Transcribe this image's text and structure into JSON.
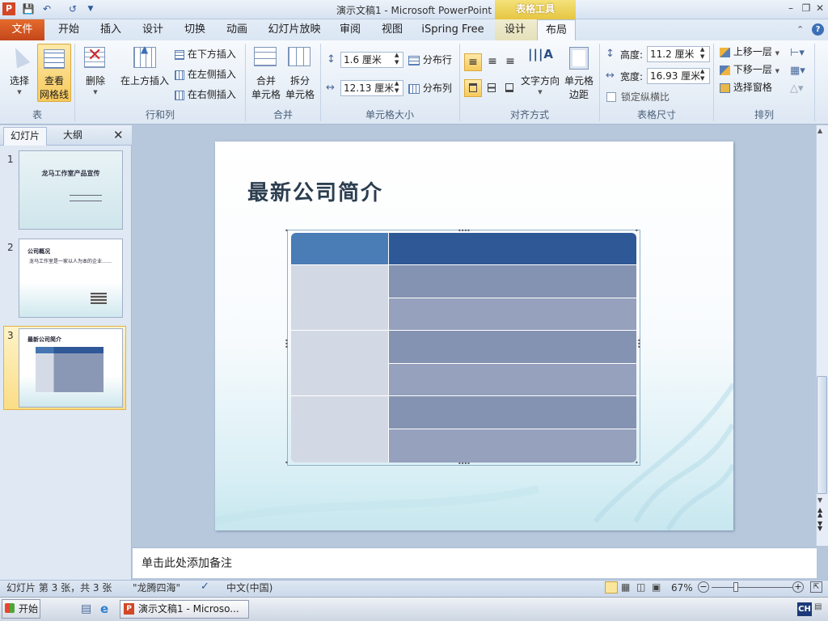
{
  "window": {
    "title": "演示文稿1 - Microsoft PowerPoint",
    "context_tab_group": "表格工具"
  },
  "quick_access": {
    "app_icon": "P",
    "save_icon": "save-icon",
    "undo_icon": "undo-icon",
    "redo_icon": "redo-icon",
    "more_icon": "customize-icon"
  },
  "tabs": [
    "文件",
    "开始",
    "插入",
    "设计",
    "切换",
    "动画",
    "幻灯片放映",
    "审阅",
    "视图",
    "iSpring Free",
    "设计",
    "布局"
  ],
  "ribbon": {
    "table_group": {
      "select": "选择",
      "view_gridlines_1": "查看",
      "view_gridlines_2": "网格线",
      "label": "表"
    },
    "rows_cols": {
      "delete": "删除",
      "insert_above": "在上方插入",
      "insert_below": "在下方插入",
      "insert_left": "在左侧插入",
      "insert_right": "在右侧插入",
      "label": "行和列"
    },
    "merge": {
      "merge_1": "合并",
      "merge_2": "单元格",
      "split_1": "拆分",
      "split_2": "单元格",
      "label": "合并"
    },
    "cell_size": {
      "height_value": "1.6 厘米",
      "width_value": "12.13 厘米",
      "distribute_rows": "分布行",
      "distribute_cols": "分布列",
      "label": "单元格大小"
    },
    "alignment": {
      "text_direction": "文字方向",
      "cell_margins_1": "单元格",
      "cell_margins_2": "边距",
      "label": "对齐方式"
    },
    "table_size": {
      "height_label": "高度:",
      "height_value": "11.2 厘米",
      "width_label": "宽度:",
      "width_value": "16.93 厘米",
      "lock_ratio": "锁定纵横比",
      "label": "表格尺寸"
    },
    "arrange": {
      "bring_forward": "上移一层",
      "send_backward": "下移一层",
      "selection_pane": "选择窗格",
      "label": "排列"
    }
  },
  "left_pane": {
    "tabs": [
      "幻灯片",
      "大纲"
    ],
    "close_icon": "close-icon",
    "thumbnails": [
      {
        "num": "1",
        "title": "龙马工作室产品宣传"
      },
      {
        "num": "2",
        "title": "公司概况",
        "body": "龙马工作室是一家以人为本的企业……"
      },
      {
        "num": "3",
        "title": "最新公司简介"
      }
    ]
  },
  "slide": {
    "title": "最新公司简介"
  },
  "notes": {
    "placeholder": "单击此处添加备注"
  },
  "status": {
    "slide_info": "幻灯片 第 3 张，共 3 张",
    "theme": "\"龙腾四海\"",
    "language": "中文(中国)",
    "zoom": "67%"
  },
  "taskbar": {
    "start": "开始",
    "window_item": "演示文稿1 - Microso...",
    "ime": "CH"
  },
  "colors": {
    "file_tab": "#d9541f",
    "header_row": "#3f6aa6",
    "body_dark": "#8795b3",
    "body_light": "#95a1bd",
    "first_col": "#d5dbe6",
    "table_tools": "#e8c63f"
  }
}
